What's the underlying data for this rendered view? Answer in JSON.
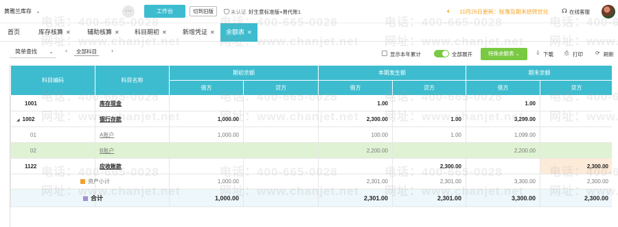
{
  "header": {
    "company": "黄雅兰库存",
    "workbench_label": "工作台",
    "switch_old_label": "切到旧版",
    "cert_status": "未认证",
    "edition": "好生意标准版+易代账1",
    "notice": "10月26日更新：账簿及期末结转优化",
    "service_label": "在线客服"
  },
  "tabs": [
    {
      "label": "首页",
      "closable": false
    },
    {
      "label": "库存核算",
      "closable": true
    },
    {
      "label": "辅助核算",
      "closable": true
    },
    {
      "label": "科目期初",
      "closable": true
    },
    {
      "label": "新增凭证",
      "closable": true
    },
    {
      "label": "余额表",
      "closable": true,
      "active": true
    }
  ],
  "toolbar": {
    "quick_search": "简单查找",
    "scope": "全部科目",
    "show_year": "显示本年累计",
    "expand_all": "全部展开",
    "special_balance": "特殊余额表",
    "download": "下载",
    "print": "打印",
    "refresh": "刷新"
  },
  "table": {
    "headers": {
      "code": "科目编码",
      "name": "科目名称",
      "opening": "期初余额",
      "current": "本期发生额",
      "closing": "期末余额",
      "debit": "借方",
      "credit": "贷方"
    },
    "rows": [
      {
        "code": "1001",
        "name": "库存现金",
        "v": [
          "",
          "",
          "1.00",
          "",
          "1.00",
          ""
        ]
      },
      {
        "code": "1002",
        "name": "银行存款",
        "v": [
          "1,000.00",
          "",
          "2,300.00",
          "1.00",
          "3,299.00",
          ""
        ]
      },
      {
        "code": "01",
        "name": "A账户",
        "v": [
          "1,000.00",
          "",
          "100.00",
          "1.00",
          "1,099.00",
          ""
        ]
      },
      {
        "code": "02",
        "name": "B账户",
        "v": [
          "",
          "",
          "2,200.00",
          "",
          "2,200.00",
          ""
        ]
      },
      {
        "code": "1122",
        "name": "应收账款",
        "v": [
          "",
          "",
          "",
          "2,300.00",
          "",
          "2,300.00"
        ]
      },
      {
        "code": "",
        "name": "资产小计",
        "v": [
          "1,000.00",
          "",
          "2,301.00",
          "2,301.00",
          "3,300.00",
          "2,300.00"
        ]
      },
      {
        "code": "",
        "name": "合计",
        "v": [
          "1,000.00",
          "",
          "2,301.00",
          "2,301.00",
          "3,300.00",
          "2,300.00"
        ]
      }
    ]
  },
  "watermark": {
    "phone": "电话：400-665-0028",
    "site": "网址：www.chanjet.net"
  },
  "colors": {
    "accent": "#3dbccf",
    "green": "#7ac943",
    "notice": "#f5a623"
  }
}
